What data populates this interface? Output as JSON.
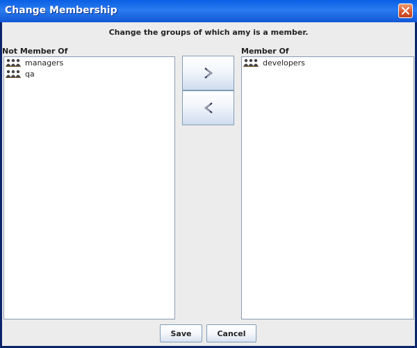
{
  "window": {
    "title": "Change Membership"
  },
  "instruction": "Change the groups of which amy is a member.",
  "not_member": {
    "label": "Not Member Of",
    "items": [
      {
        "label": "managers",
        "icon": "group-icon"
      },
      {
        "label": "qa",
        "icon": "group-icon"
      }
    ]
  },
  "member": {
    "label": "Member Of",
    "items": [
      {
        "label": "developers",
        "icon": "group-icon"
      }
    ]
  },
  "buttons": {
    "save": "Save",
    "cancel": "Cancel",
    "add_icon": "chevron-right-icon",
    "remove_icon": "chevron-left-icon"
  },
  "colors": {
    "titlebar": "#1157d6",
    "close": "#d7532a",
    "panel_bg": "#ececec"
  }
}
